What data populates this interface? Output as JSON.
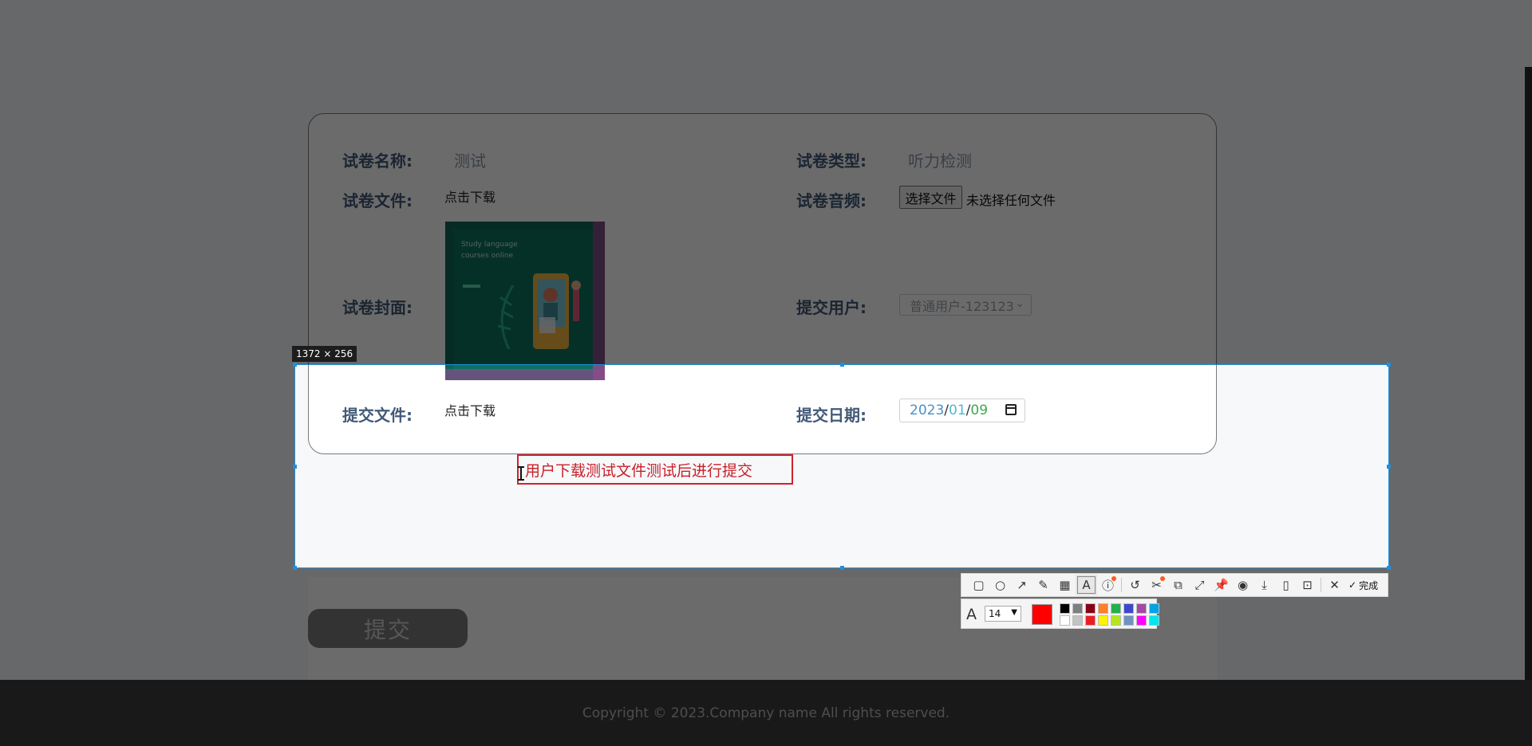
{
  "form": {
    "name_label": "试卷名称:",
    "name_value": "测试",
    "type_label": "试卷类型:",
    "type_value": "听力检测",
    "file_label": "试卷文件:",
    "file_link": "点击下载",
    "audio_label": "试卷音频:",
    "audio_button": "选择文件",
    "audio_none": "未选择任何文件",
    "cover_label": "试卷封面:",
    "cover_text_1": "Study language",
    "cover_text_2": "courses online",
    "user_label": "提交用户:",
    "user_value": "普通用户-123123",
    "submit_file_label": "提交文件:",
    "submit_file_link": "点击下载",
    "date_label": "提交日期:",
    "date_year": "2023",
    "date_month": "01",
    "date_day": "09",
    "submit_button": "提交"
  },
  "footer": {
    "copyright": "Copyright © 2023.Company name All rights reserved."
  },
  "screenshot_tool": {
    "selection_size": "1372 × 256",
    "annotation_text": "用户下载测试文件测试后进行提交",
    "font_size": "14",
    "done_label": "完成",
    "current_color": "#ff0000",
    "palette": [
      "#000000",
      "#7f7f7f",
      "#880015",
      "#ff7f27",
      "#22b14c",
      "#3f48cc",
      "#a349a4",
      "#00a2e8",
      "#ffffff",
      "#c3c3c3",
      "#ed1c24",
      "#fff200",
      "#b5e61d",
      "#7092be",
      "#ff00ff",
      "#00e5ee"
    ]
  }
}
